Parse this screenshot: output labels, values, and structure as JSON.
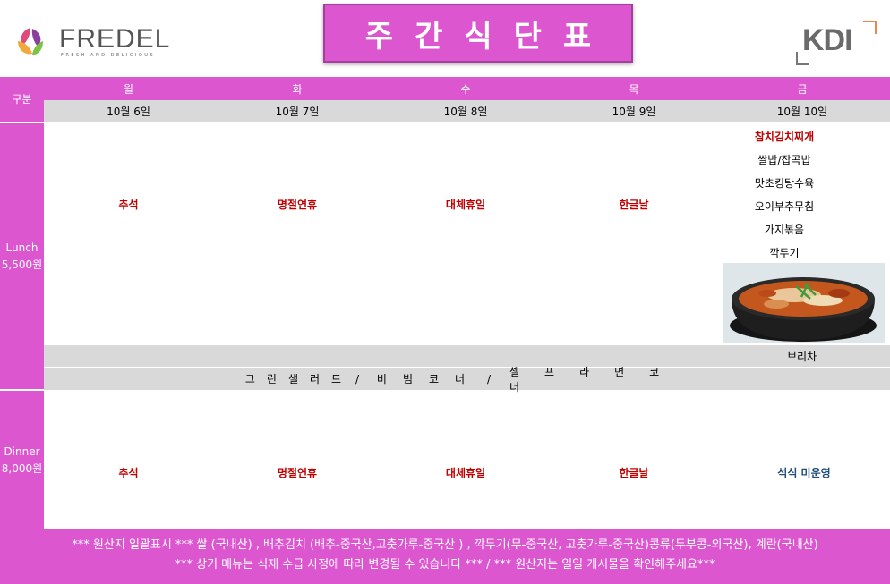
{
  "header": {
    "brand_name": "FREDEL",
    "brand_tagline": "FRESH AND DELICIOUS",
    "title": "주간식단표",
    "partner_logo": "KDI"
  },
  "table": {
    "category_label": "구분",
    "days": [
      {
        "weekday": "월",
        "date": "10월 6일"
      },
      {
        "weekday": "화",
        "date": "10월 7일"
      },
      {
        "weekday": "수",
        "date": "10월 8일"
      },
      {
        "weekday": "목",
        "date": "10월 9일"
      },
      {
        "weekday": "금",
        "date": "10월 10일"
      }
    ],
    "lunch": {
      "label": "Lunch",
      "price": "5,500원",
      "holidays": [
        "추석",
        "명절연휴",
        "대체휴일",
        "한글날"
      ],
      "friday_menu": [
        "참치김치찌개",
        "쌀밥/잡곡밥",
        "맛초킹탕수육",
        "오이부추무침",
        "가지볶음",
        "깍두기"
      ],
      "friday_drink": "보리차",
      "food_image": "kimchi-stew-photo"
    },
    "corner": [
      "그린샐러드",
      "비빔코너",
      "셀프라면코너"
    ],
    "dinner": {
      "label": "Dinner",
      "price": "8,000원",
      "holidays": [
        "추석",
        "명절연휴",
        "대체휴일",
        "한글날"
      ],
      "friday": "석식 미운영"
    }
  },
  "footer": {
    "origin_line": "*** 원산지 일괄표시 *** 쌀 (국내산) ,  배추김치 (배추-중국산,고춧가루-중국산 )  , 깍두기(무-중국산, 고춧가루-중국산)콩류(두부콩-외국산), 계란(국내산)",
    "notice_line": "*** 상기 메뉴는 식재 수급 사정에 따라 변경될 수 있습니다 *** / *** 원산지는 일일 게시물을 확인해주세요***"
  },
  "colors": {
    "accent": "#dc56d0",
    "holiday": "#c00000",
    "gray_row": "#d9d9d9",
    "dinner_note": "#1f4e79"
  }
}
